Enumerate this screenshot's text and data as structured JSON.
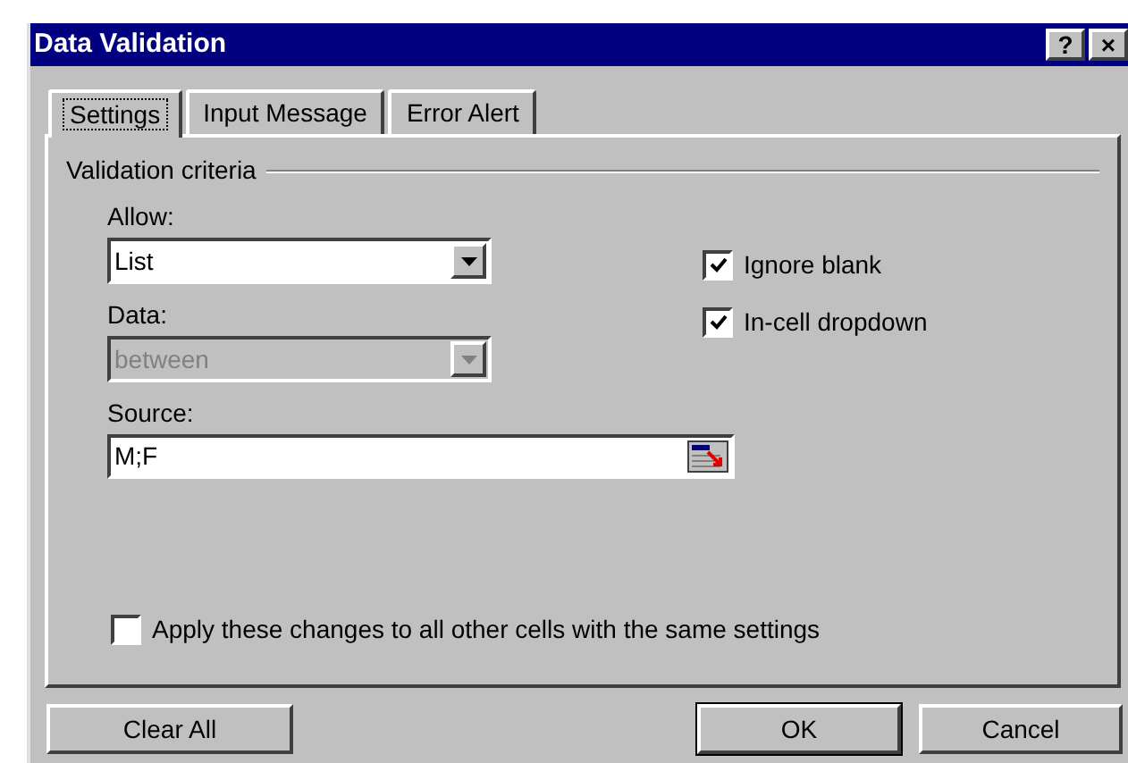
{
  "window": {
    "title": "Data Validation",
    "title_buttons": [
      "?",
      "×"
    ]
  },
  "tabs": [
    {
      "label": "Settings",
      "selected": true
    },
    {
      "label": "Input Message",
      "selected": false
    },
    {
      "label": "Error Alert",
      "selected": false
    }
  ],
  "group_title": "Validation criteria",
  "dropdowns": [
    {
      "label": "Allow:",
      "value": "List",
      "disabled": false
    },
    {
      "label": "Data:",
      "value": "between",
      "disabled": true
    }
  ],
  "source": {
    "label": "Source:",
    "value": "M;F"
  },
  "options": [
    {
      "label": "Ignore blank",
      "checked": true
    },
    {
      "label": "In-cell dropdown",
      "checked": true
    }
  ],
  "apply_option": {
    "label": "Apply these changes to all other cells with the same settings",
    "checked": false
  },
  "buttons": [
    {
      "label": "Clear All",
      "default": false
    },
    {
      "label": "OK",
      "default": true
    },
    {
      "label": "Cancel",
      "default": false
    }
  ]
}
